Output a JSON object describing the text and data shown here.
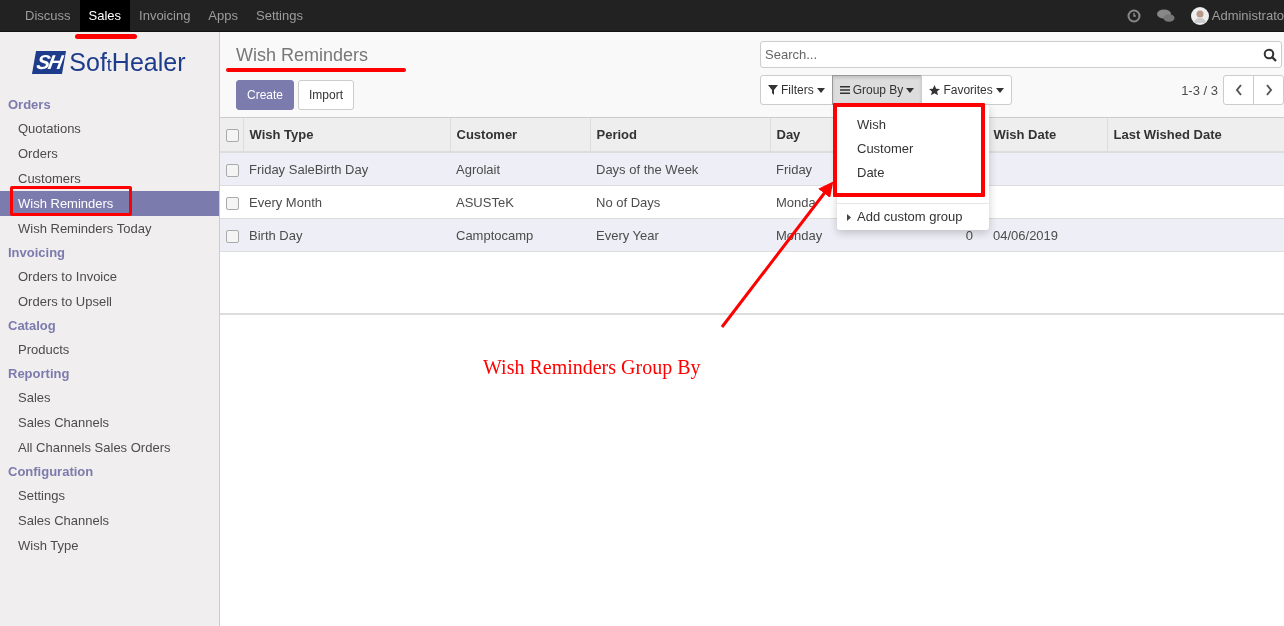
{
  "top_menu": [
    {
      "label": "Discuss",
      "selected": false
    },
    {
      "label": "Sales",
      "selected": true
    },
    {
      "label": "Invoicing",
      "selected": false
    },
    {
      "label": "Apps",
      "selected": false
    },
    {
      "label": "Settings",
      "selected": false
    }
  ],
  "user": {
    "name": "Administrato"
  },
  "logo": {
    "mark": "SH",
    "name_start": "Sof",
    "name_mid": "t",
    "name_end": "Healer"
  },
  "sidebar": [
    {
      "heading": "Orders",
      "items": [
        {
          "label": "Quotations",
          "selected": false
        },
        {
          "label": "Orders",
          "selected": false
        },
        {
          "label": "Customers",
          "selected": false
        },
        {
          "label": "Wish Reminders",
          "selected": true
        },
        {
          "label": "Wish Reminders Today",
          "selected": false
        }
      ]
    },
    {
      "heading": "Invoicing",
      "items": [
        {
          "label": "Orders to Invoice",
          "selected": false
        },
        {
          "label": "Orders to Upsell",
          "selected": false
        }
      ]
    },
    {
      "heading": "Catalog",
      "items": [
        {
          "label": "Products",
          "selected": false
        }
      ]
    },
    {
      "heading": "Reporting",
      "items": [
        {
          "label": "Sales",
          "selected": false
        },
        {
          "label": "Sales Channels",
          "selected": false
        },
        {
          "label": "All Channels Sales Orders",
          "selected": false
        }
      ]
    },
    {
      "heading": "Configuration",
      "items": [
        {
          "label": "Settings",
          "selected": false
        },
        {
          "label": "Sales Channels",
          "selected": false
        },
        {
          "label": "Wish Type",
          "selected": false
        }
      ]
    }
  ],
  "title": "Wish Reminders",
  "buttons": {
    "create": "Create",
    "import": "Import"
  },
  "search": {
    "placeholder": "Search..."
  },
  "search_buttons": [
    {
      "label": "Filters",
      "selected": false
    },
    {
      "label": "Group By",
      "selected": true
    },
    {
      "label": "Favorites",
      "selected": false
    }
  ],
  "pager": "1-3 / 3",
  "group_by_menu": {
    "options": [
      "Wish",
      "Customer",
      "Date"
    ],
    "custom": "Add custom group"
  },
  "table": {
    "columns": [
      "Wish Type",
      "Customer",
      "Period",
      "Day",
      "",
      "Wish Date",
      "Last Wished Date"
    ],
    "select_all_checked": false,
    "rows": [
      {
        "checked": false,
        "cells": [
          "Friday SaleBirth Day",
          "Agrolait",
          "Days of the Week",
          "Friday",
          "",
          "",
          ""
        ]
      },
      {
        "checked": false,
        "cells": [
          "Every Month",
          "ASUSTeK",
          "No of Days",
          "Monda",
          "",
          "",
          ""
        ]
      },
      {
        "checked": false,
        "cells": [
          "Birth Day",
          "Camptocamp",
          "Every Year",
          "Monday",
          "0",
          "04/06/2019",
          ""
        ]
      }
    ]
  },
  "annotation": "Wish Reminders Group By"
}
